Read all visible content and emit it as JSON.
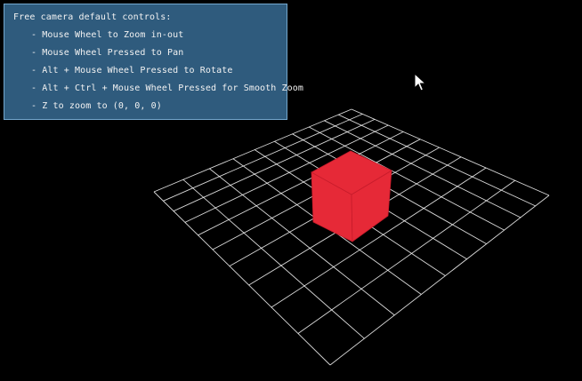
{
  "window": {
    "background": "#000000"
  },
  "info_panel": {
    "title": "Free camera default controls:",
    "items": [
      "- Mouse Wheel to Zoom in-out",
      "- Mouse Wheel Pressed to Pan",
      "- Alt + Mouse Wheel Pressed to Rotate",
      "- Alt + Ctrl + Mouse Wheel Pressed for Smooth Zoom",
      "- Z to zoom to (0, 0, 0)"
    ],
    "background": "#2f5b7d",
    "border": "#74a8cf",
    "text_color": "#f2f2f2"
  },
  "scene": {
    "grid": {
      "lines_per_side": 11,
      "color": "#ffffff"
    },
    "cube": {
      "color": "#e62937",
      "edge_color": "#c71c2b"
    }
  },
  "cursor": {
    "icon": "mouse-pointer-icon"
  }
}
